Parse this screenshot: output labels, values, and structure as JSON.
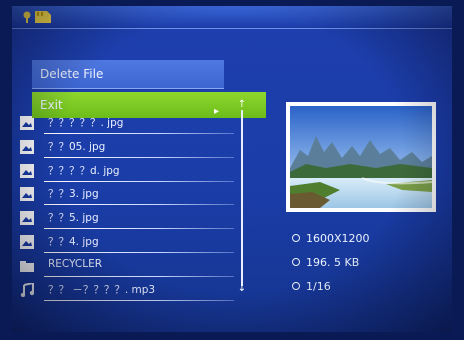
{
  "context_menu": {
    "delete_label": "Delete File",
    "exit_label": "Exit",
    "exit_arrow": "▸"
  },
  "files": [
    {
      "name": "？？？？？. jpg",
      "icon": "image-icon"
    },
    {
      "name": "？？05. jpg",
      "icon": "image-icon"
    },
    {
      "name": "？？？？d. jpg",
      "icon": "image-icon"
    },
    {
      "name": "？？3. jpg",
      "icon": "image-icon"
    },
    {
      "name": "？？5. jpg",
      "icon": "image-icon"
    },
    {
      "name": "？？4. jpg",
      "icon": "image-icon"
    },
    {
      "name": "RECYCLER",
      "icon": "folder-icon"
    },
    {
      "name": "？？ －？？？？. mp3",
      "icon": "music-note-icon"
    }
  ],
  "details": {
    "resolution": "1600X1200",
    "size": "196. 5 KB",
    "position": "1/16"
  },
  "colors": {
    "background": "#1a3da8",
    "menu_blue": "#3d66d2",
    "highlight_green": "#7cc522"
  }
}
